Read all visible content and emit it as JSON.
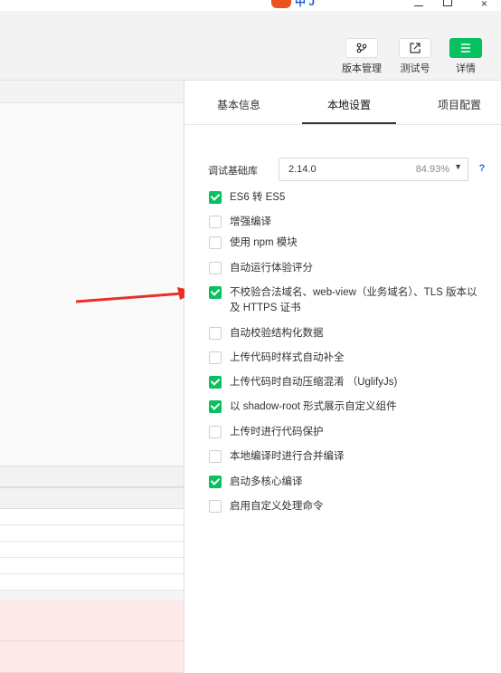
{
  "title_bar": {
    "logo_text": "中 J"
  },
  "toolbar": {
    "buttons": [
      {
        "label": "版本管理",
        "icon": "version-icon"
      },
      {
        "label": "测试号",
        "icon": "external-link-icon"
      },
      {
        "label": "详情",
        "icon": "menu-icon"
      }
    ]
  },
  "panel": {
    "tabs": [
      "基本信息",
      "本地设置",
      "项目配置"
    ],
    "active_tab": "本地设置",
    "base_lib": {
      "label": "调试基础库",
      "version": "2.14.0",
      "coverage": "84.93%"
    },
    "help_label": "?",
    "options": [
      {
        "label": "ES6 转 ES5",
        "checked": true
      },
      {
        "label": "增强编译",
        "checked": false
      },
      {
        "label": "使用 npm 模块",
        "checked": false
      },
      {
        "label": "自动运行体验评分",
        "checked": false
      },
      {
        "label": "不校验合法域名、web-view（业务域名）、TLS 版本以及 HTTPS 证书",
        "checked": true
      },
      {
        "label": "自动校验结构化数据",
        "checked": false
      },
      {
        "label": "上传代码时样式自动补全",
        "checked": false
      },
      {
        "label": "上传代码时自动压缩混淆 （UglifyJs)",
        "checked": true
      },
      {
        "label": "以 shadow-root 形式展示自定义组件",
        "checked": true
      },
      {
        "label": "上传时进行代码保护",
        "checked": false
      },
      {
        "label": "本地编译时进行合并编译",
        "checked": false
      },
      {
        "label": "启动多核心编译",
        "checked": true
      },
      {
        "label": "启用自定义处理命令",
        "checked": false
      }
    ]
  },
  "colors": {
    "accent": "#07c160",
    "arrow": "#e8302a",
    "help": "#1f6fe5"
  }
}
